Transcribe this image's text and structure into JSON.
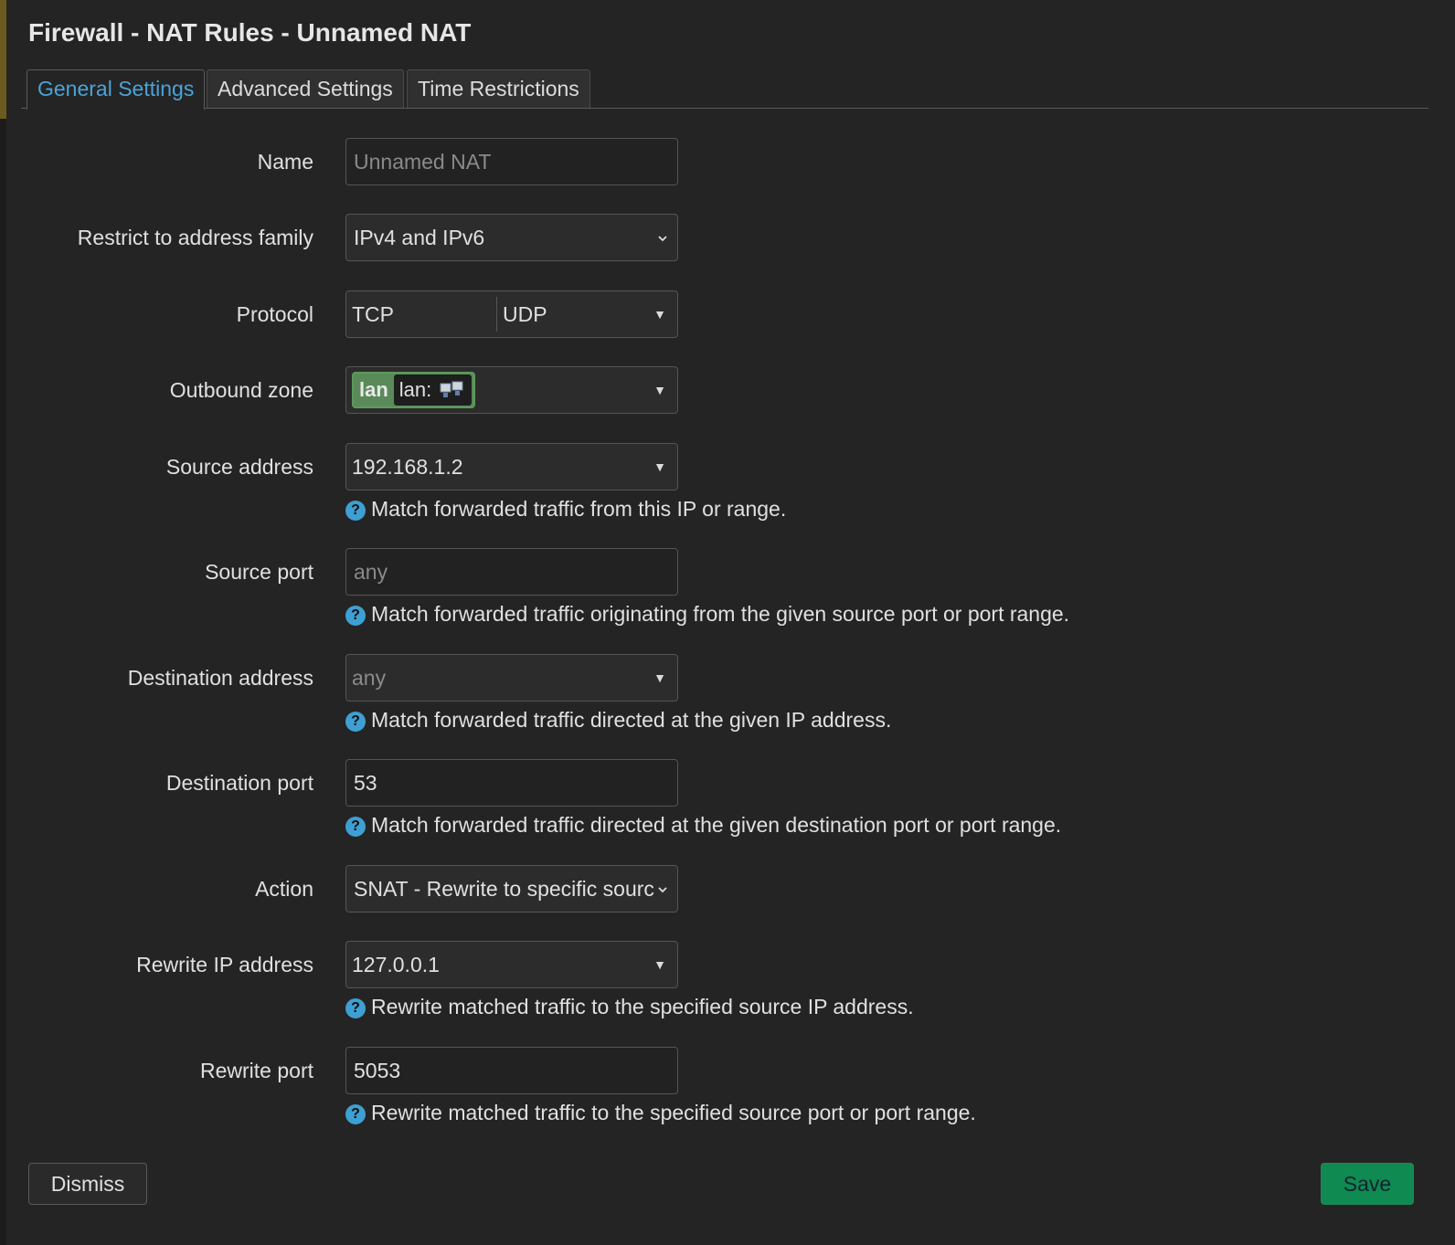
{
  "title": "Firewall - NAT Rules - Unnamed NAT",
  "tabs": [
    {
      "label": "General Settings",
      "active": true
    },
    {
      "label": "Advanced Settings",
      "active": false
    },
    {
      "label": "Time Restrictions",
      "active": false
    }
  ],
  "fields": {
    "name": {
      "label": "Name",
      "placeholder": "Unnamed NAT"
    },
    "family": {
      "label": "Restrict to address family",
      "value": "IPv4 and IPv6"
    },
    "protocol": {
      "label": "Protocol",
      "values": [
        "TCP",
        "UDP"
      ]
    },
    "outbound_zone": {
      "label": "Outbound zone",
      "zone": "lan",
      "iface": "lan:"
    },
    "source_address": {
      "label": "Source address",
      "value": "192.168.1.2",
      "help": "Match forwarded traffic from this IP or range."
    },
    "source_port": {
      "label": "Source port",
      "placeholder": "any",
      "help": "Match forwarded traffic originating from the given source port or port range."
    },
    "dest_address": {
      "label": "Destination address",
      "placeholder": "any",
      "help": "Match forwarded traffic directed at the given IP address."
    },
    "dest_port": {
      "label": "Destination port",
      "value": "53",
      "help": "Match forwarded traffic directed at the given destination port or port range."
    },
    "action": {
      "label": "Action",
      "value": "SNAT - Rewrite to specific sourc"
    },
    "rewrite_ip": {
      "label": "Rewrite IP address",
      "value": "127.0.0.1",
      "help": "Rewrite matched traffic to the specified source IP address."
    },
    "rewrite_port": {
      "label": "Rewrite port",
      "value": "5053",
      "help": "Rewrite matched traffic to the specified source port or port range."
    }
  },
  "buttons": {
    "dismiss": "Dismiss",
    "save": "Save"
  },
  "colors": {
    "accent": "#4aa3d9",
    "save": "#0f8a50",
    "zone_lan": "#5a8a5a"
  }
}
